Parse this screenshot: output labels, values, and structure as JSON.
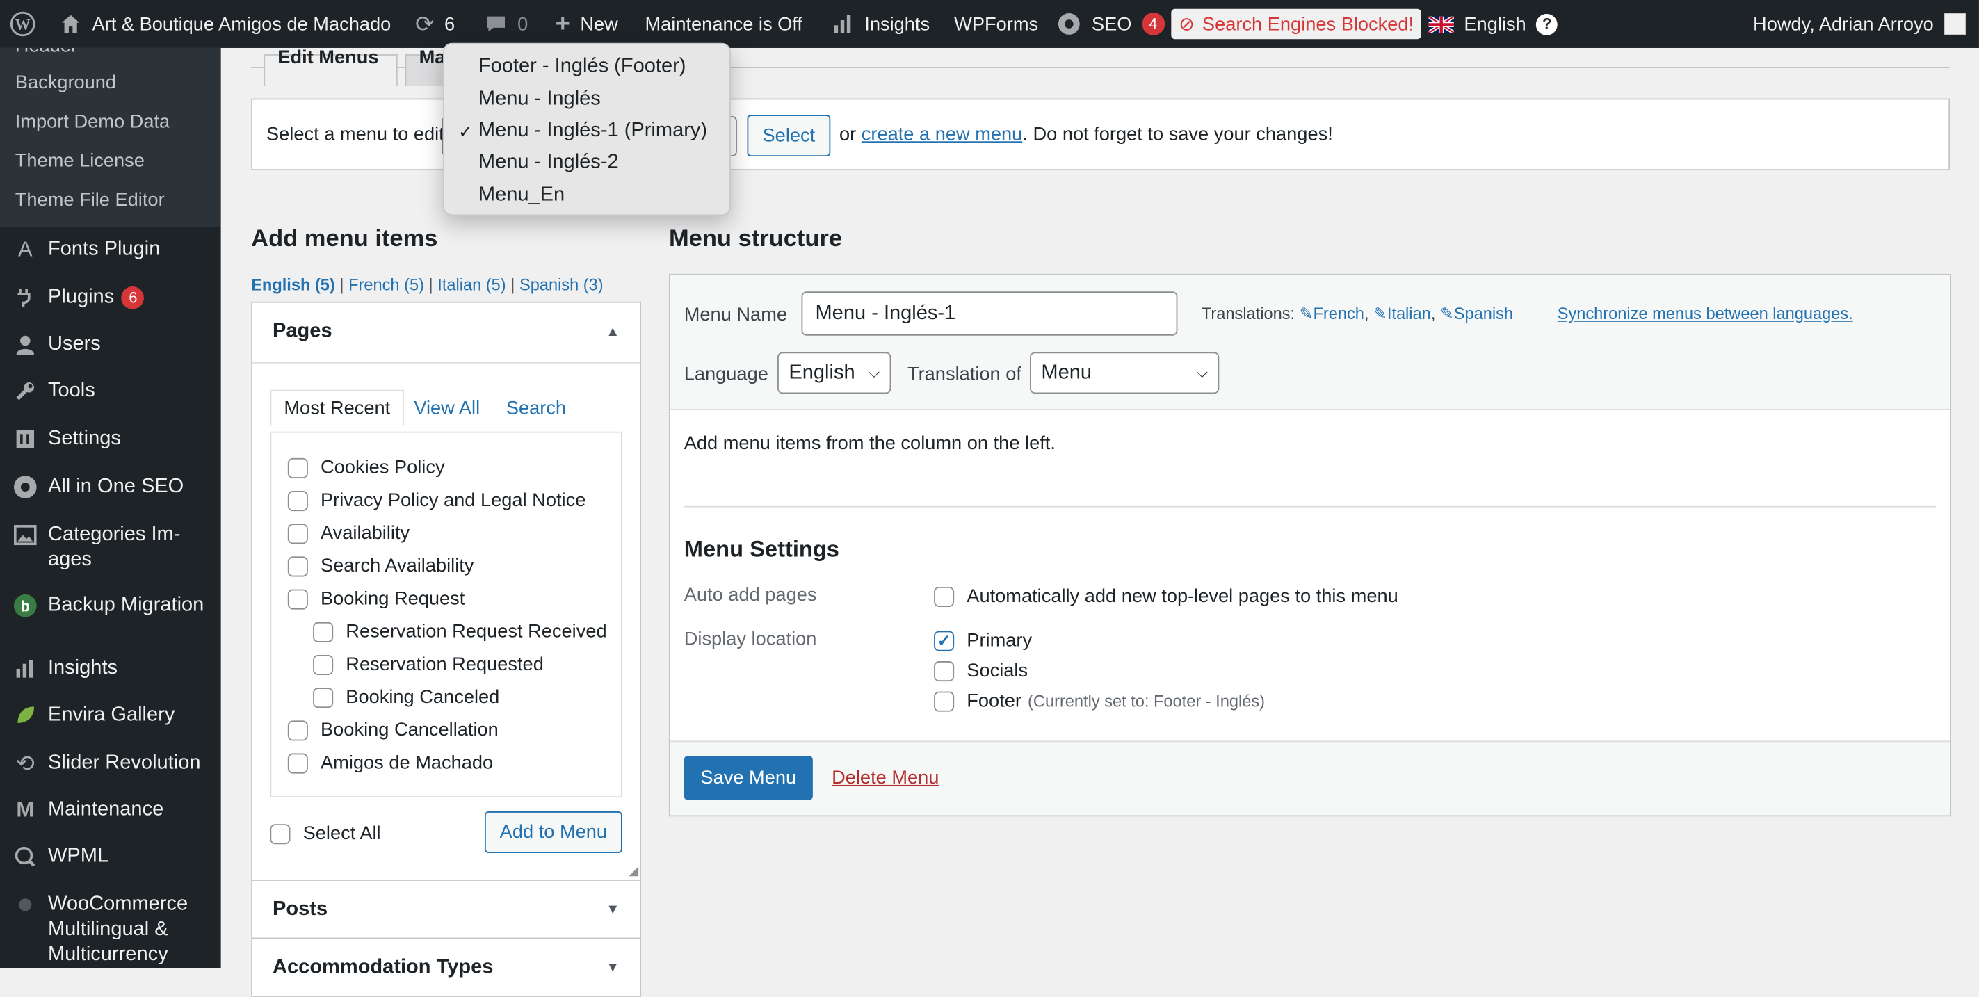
{
  "adminbar": {
    "site_name": "Art & Boutique Amigos de Machado",
    "updates_count": "6",
    "comments_count": "0",
    "new_label": "New",
    "maintenance_label": "Maintenance is Off",
    "insights_label": "Insights",
    "wpforms_label": "WPForms",
    "seo_label": "SEO",
    "seo_count": "4",
    "search_blocked_label": "Search Engines Blocked!",
    "language_label": "English",
    "howdy_label": "Howdy, Adrian Arroyo"
  },
  "sidebar": {
    "submenu": [
      "Header",
      "Background",
      "Import Demo Data",
      "Theme License",
      "Theme File Editor"
    ],
    "items": [
      {
        "label": "Fonts Plugin",
        "icon": "font-icon"
      },
      {
        "label": "Plugins",
        "icon": "plug-icon",
        "badge": "6"
      },
      {
        "label": "Users",
        "icon": "user-icon"
      },
      {
        "label": "Tools",
        "icon": "wrench-icon"
      },
      {
        "label": "Settings",
        "icon": "settings-icon"
      },
      {
        "label": "All in One SEO",
        "icon": "aioseo-icon"
      },
      {
        "label": "Categories Im-",
        "label2": "ages",
        "icon": "image-icon"
      },
      {
        "label": "Backup Migration",
        "icon": "backup-icon"
      },
      {
        "label": "Insights",
        "icon": "chart-icon"
      },
      {
        "label": "Envira Gallery",
        "icon": "leaf-icon"
      },
      {
        "label": "Slider Revolution",
        "icon": "refresh-icon"
      },
      {
        "label": "Maintenance",
        "icon": "m-icon"
      },
      {
        "label": "WPML",
        "icon": "wpml-icon"
      },
      {
        "label": "WooCommerce",
        "label2": "Multilingual &",
        "label3": "Multicurrency",
        "icon": "woo-icon"
      }
    ]
  },
  "tabs": {
    "edit_menus": "Edit Menus",
    "manage_locations": "Ma"
  },
  "select_bar": {
    "prefix": "Select a menu to edit:",
    "select_button": "Select",
    "or_text": "or",
    "create_link": "create a new menu",
    "suffix": ". Do not forget to save your changes!"
  },
  "dropdown": {
    "options": [
      "Footer - Inglés (Footer)",
      "Menu - Inglés",
      "Menu - Inglés-1 (Primary)",
      "Menu - Inglés-2",
      "Menu_En"
    ],
    "selected_index": 2,
    "checkmark": "✓"
  },
  "add_items": {
    "title": "Add menu items",
    "languages": [
      {
        "label": "English (5)",
        "active": true
      },
      {
        "label": "French (5)"
      },
      {
        "label": "Italian (5)"
      },
      {
        "label": "Spanish (3)"
      }
    ],
    "separator": "|",
    "pages_title": "Pages",
    "tabs": [
      "Most Recent",
      "View All",
      "Search"
    ],
    "pages": [
      {
        "label": "Cookies Policy",
        "indent": 0
      },
      {
        "label": "Privacy Policy and Legal Notice",
        "indent": 0
      },
      {
        "label": "Availability",
        "indent": 0
      },
      {
        "label": "Search Availability",
        "indent": 0
      },
      {
        "label": "Booking Request",
        "indent": 0
      },
      {
        "label": "Reservation Request Received",
        "indent": 1
      },
      {
        "label": "Reservation Requested",
        "indent": 1
      },
      {
        "label": "Booking Canceled",
        "indent": 1
      },
      {
        "label": "Booking Cancellation",
        "indent": 0
      },
      {
        "label": "Amigos de Machado",
        "indent": 0
      }
    ],
    "select_all": "Select All",
    "add_button": "Add to Menu",
    "posts_title": "Posts",
    "accommodation_title": "Accommodation Types"
  },
  "structure": {
    "title": "Menu structure",
    "menu_name_label": "Menu Name",
    "menu_name_value": "Menu - Inglés-1",
    "translations_label": "Translations:",
    "translations": [
      "French",
      "Italian",
      "Spanish"
    ],
    "sync_link": "Synchronize menus between languages.",
    "language_label": "Language",
    "language_value": "English",
    "translation_of_label": "Translation of",
    "translation_of_value": "Menu",
    "hint": "Add menu items from the column on the left.",
    "settings_title": "Menu Settings",
    "auto_add_label": "Auto add pages",
    "auto_add_option": "Automatically add new top-level pages to this menu",
    "display_location_label": "Display location",
    "locations": [
      {
        "label": "Primary",
        "checked": true
      },
      {
        "label": "Socials",
        "checked": false
      },
      {
        "label": "Footer",
        "note": "(Currently set to: Footer - Inglés)",
        "checked": false
      }
    ],
    "save_button": "Save Menu",
    "delete_link": "Delete Menu"
  }
}
